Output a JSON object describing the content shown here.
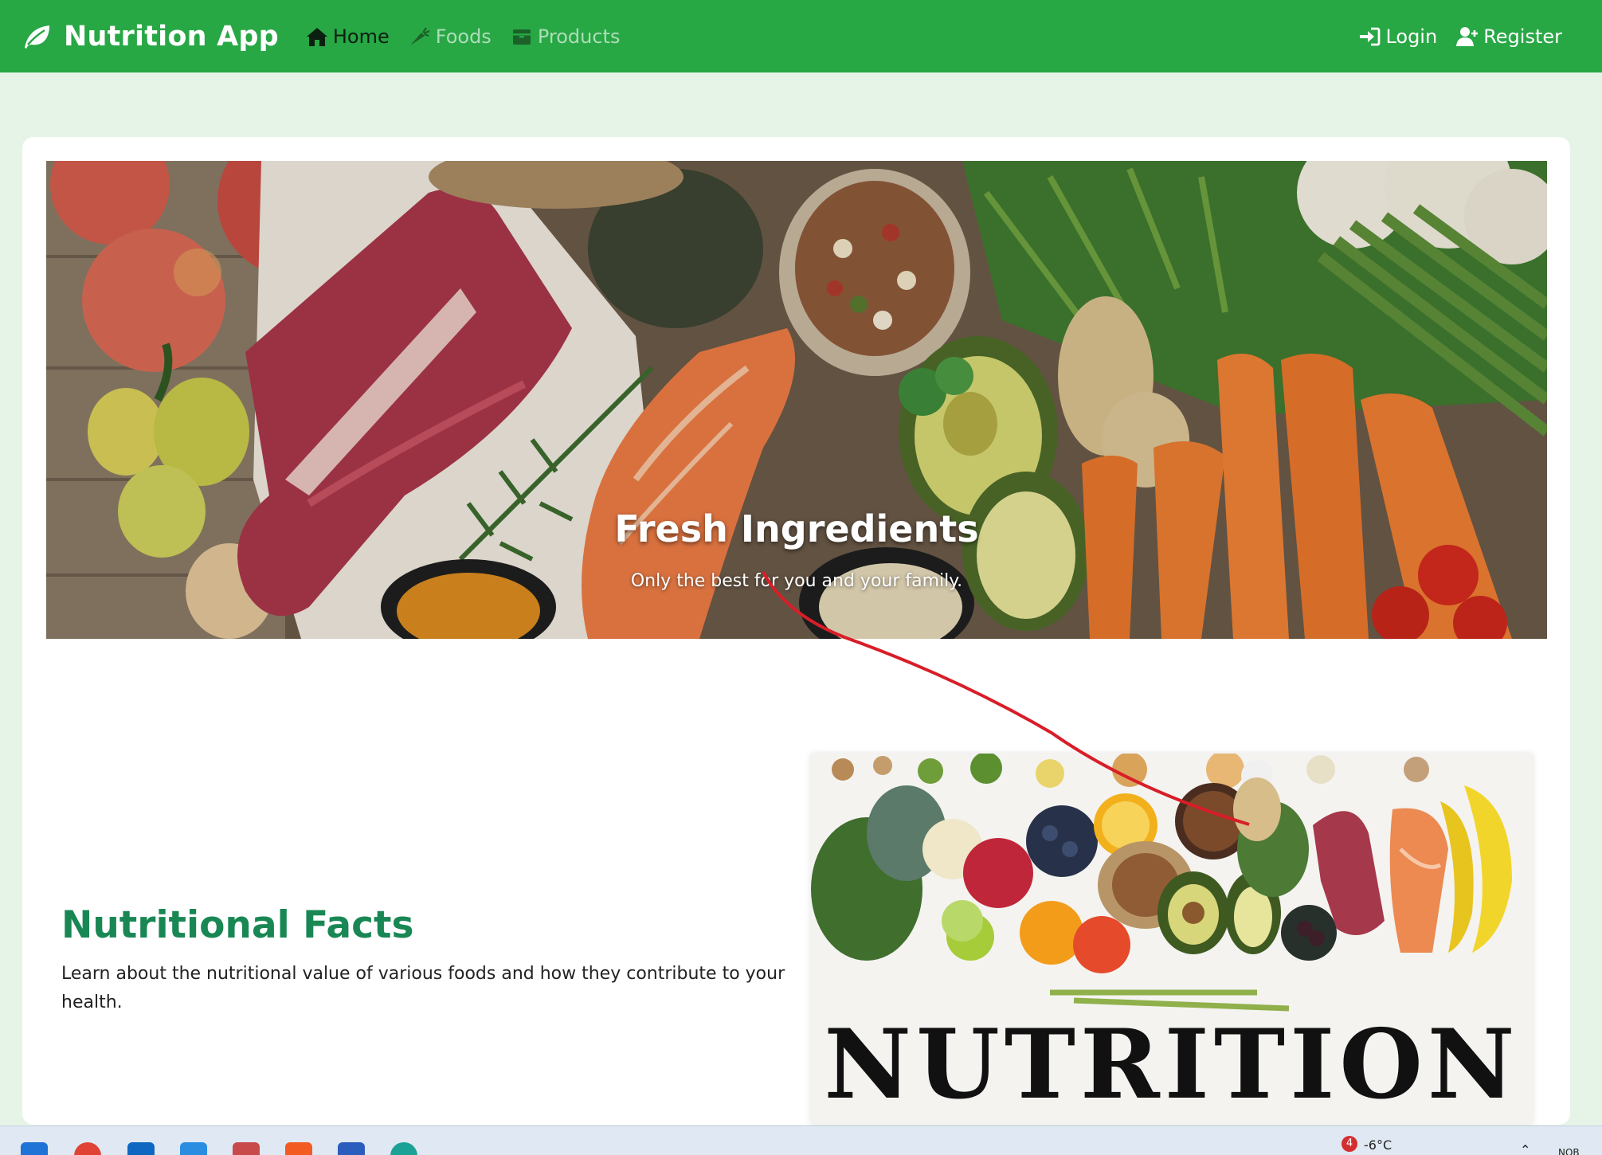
{
  "navbar": {
    "brand": "Nutrition App",
    "links": [
      {
        "label": "Home",
        "icon": "home-icon",
        "active": true
      },
      {
        "label": "Foods",
        "icon": "carrot-icon",
        "active": false
      },
      {
        "label": "Products",
        "icon": "box-icon",
        "active": false
      }
    ],
    "auth": [
      {
        "label": "Login",
        "icon": "sign-in-icon"
      },
      {
        "label": "Register",
        "icon": "user-plus-icon"
      }
    ],
    "color": "#28a745"
  },
  "hero": {
    "title": "Fresh Ingredients",
    "subtitle": "Only the best for you and your family."
  },
  "facts": {
    "title": "Nutritional Facts",
    "body": "Learn about the nutritional value of various foods and how they contribute to your health."
  },
  "nutrition_image": {
    "word": "NUTRITION"
  },
  "taskbar": {
    "notification_count": "4",
    "temperature": "-6°C",
    "tray_text": "NOB",
    "apps": [
      "windows-start-icon",
      "chrome-icon",
      "outlook-icon",
      "vscode-icon",
      "app-icon",
      "brave-icon",
      "word-icon",
      "edge-icon"
    ]
  }
}
